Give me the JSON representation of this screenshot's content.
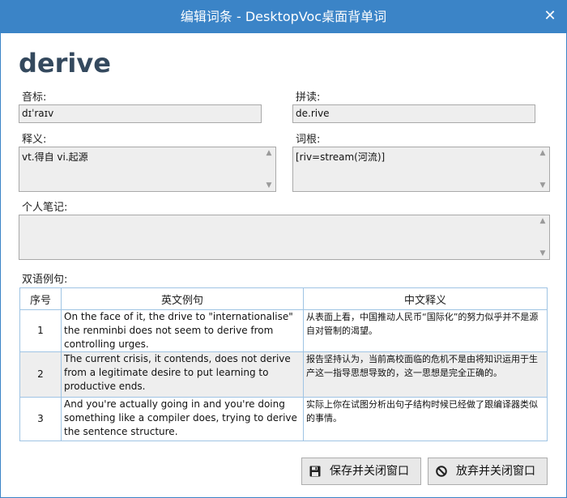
{
  "window": {
    "title": "编辑词条 - DesktopVoc桌面背单词",
    "close_glyph": "✕",
    "titlebar_color": "#3b84c7"
  },
  "entry": {
    "word": "derive",
    "phonetic_label": "音标:",
    "phonetic_value": "dɪˈraɪv",
    "spelling_label": "拼读:",
    "spelling_value": "de.rive",
    "meaning_label": "释义:",
    "meaning_value": "vt.得自 vi.起源",
    "root_label": "词根:",
    "root_value": "[riv=stream(河流)]",
    "notes_label": "个人笔记:",
    "notes_value": ""
  },
  "examples": {
    "label": "双语例句:",
    "headers": [
      "序号",
      "英文例句",
      "中文释义"
    ],
    "rows": [
      {
        "num": "1",
        "en": "On the face of it, the drive to \"internationalise\" the renminbi does not seem to derive from controlling urges.",
        "zh": "从表面上看，中国推动人民币“国际化”的努力似乎并不是源自对管制的渴望。"
      },
      {
        "num": "2",
        "en": "The current crisis, it contends, does not derive from a legitimate desire to put learning to productive ends.",
        "zh": "报告坚持认为，当前高校面临的危机不是由将知识运用于生产这一指导思想导致的，这一思想是完全正确的。"
      },
      {
        "num": "3",
        "en": "And you're actually going in and you're doing something like a compiler does, trying to derive the sentence structure.",
        "zh": "实际上你在试图分析出句子结构时候已经做了跟编译器类似的事情。"
      }
    ]
  },
  "buttons": {
    "save_label": "保存并关闭窗口",
    "save_icon": "floppy-disk-icon",
    "discard_label": "放弃并关闭窗口",
    "discard_icon": "prohibited-icon"
  }
}
